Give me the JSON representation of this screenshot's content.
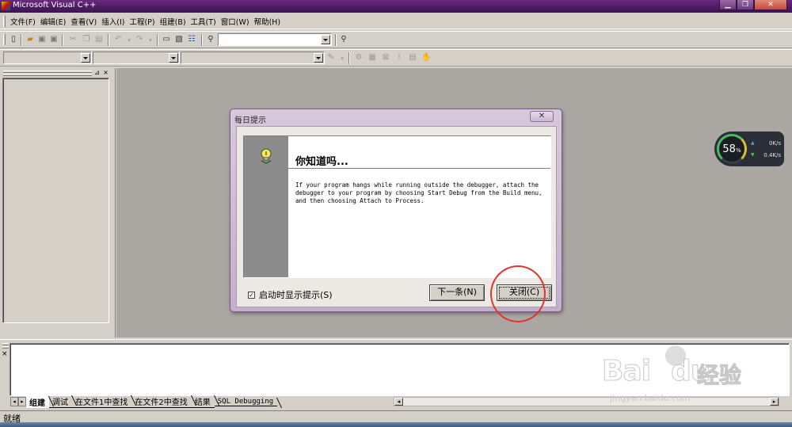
{
  "window": {
    "title": "Microsoft Visual C++",
    "min": "▁",
    "max": "❐",
    "close": "✕"
  },
  "menu": [
    "文件(F)",
    "编辑(E)",
    "查看(V)",
    "插入(I)",
    "工程(P)",
    "组建(B)",
    "工具(T)",
    "窗口(W)",
    "帮助(H)"
  ],
  "dialog": {
    "title": "每日提示",
    "close_glyph": "✕",
    "heading": "你知道吗...",
    "tip": "If your program hangs while running outside the debugger, attach the debugger to your program by choosing Start Debug from the Build menu, and then choosing Attach to Process.",
    "checkbox_label": "启动时显示提示(S)",
    "checkbox_checked": true,
    "check_glyph": "✓",
    "next_button": "下一条(N)",
    "close_button": "关闭(C)"
  },
  "output_tabs": [
    "组建",
    "调试",
    "在文件1中查找",
    "在文件2中查找",
    "结果",
    "SQL Debugging"
  ],
  "active_tab": "组建",
  "status": "就绪",
  "net_widget": {
    "percent": "58",
    "unit": "%",
    "up": "0K/s",
    "down": "0.4K/s"
  },
  "watermark": {
    "brand": "Bai",
    "brand2": "du",
    "cn": "经验",
    "url": "jingyan.baidu.com"
  },
  "colors": {
    "accent_red": "#e0342c",
    "titlebar": "#4b1c63"
  }
}
